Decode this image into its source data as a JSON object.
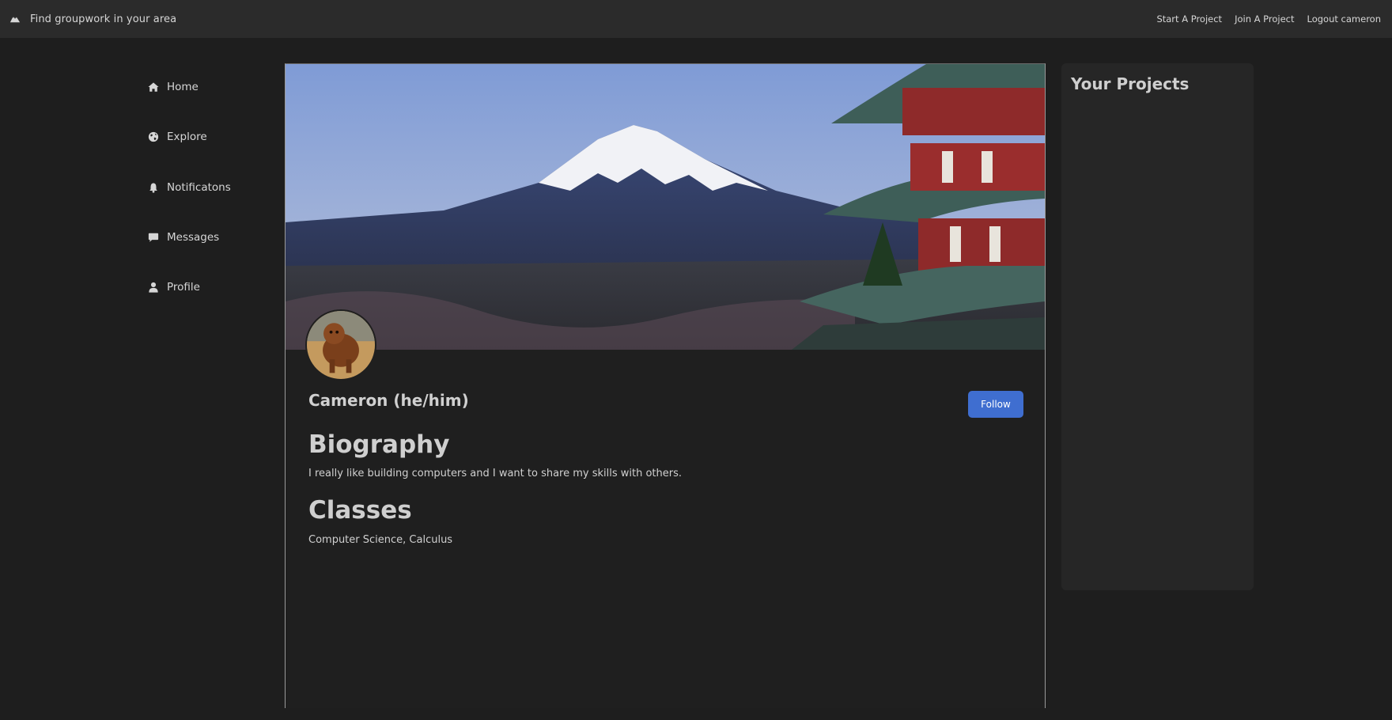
{
  "navbar": {
    "brand_icon": "mountain-icon",
    "brand_text": "Find groupwork in your area",
    "links": [
      "Start A Project",
      "Join A Project",
      "Logout cameron"
    ]
  },
  "sidebar": {
    "items": [
      {
        "label": "Home",
        "icon": "home-icon"
      },
      {
        "label": "Explore",
        "icon": "globe-icon"
      },
      {
        "label": "Notificatons",
        "icon": "bell-icon"
      },
      {
        "label": "Messages",
        "icon": "message-icon"
      },
      {
        "label": "Profile",
        "icon": "user-icon"
      }
    ]
  },
  "profile": {
    "name": "Cameron (he/him)",
    "follow_label": "Follow",
    "biography_heading": "Biography",
    "biography_text": "I really like building computers and I want to share my skills with others.",
    "classes_heading": "Classes",
    "classes_text": "Computer Science, Calculus"
  },
  "projects_panel": {
    "title": "Your Projects"
  },
  "colors": {
    "background": "#1e1e1e",
    "navbar": "#2b2b2b",
    "accent": "#3f6ed0",
    "panel": "#262626"
  }
}
